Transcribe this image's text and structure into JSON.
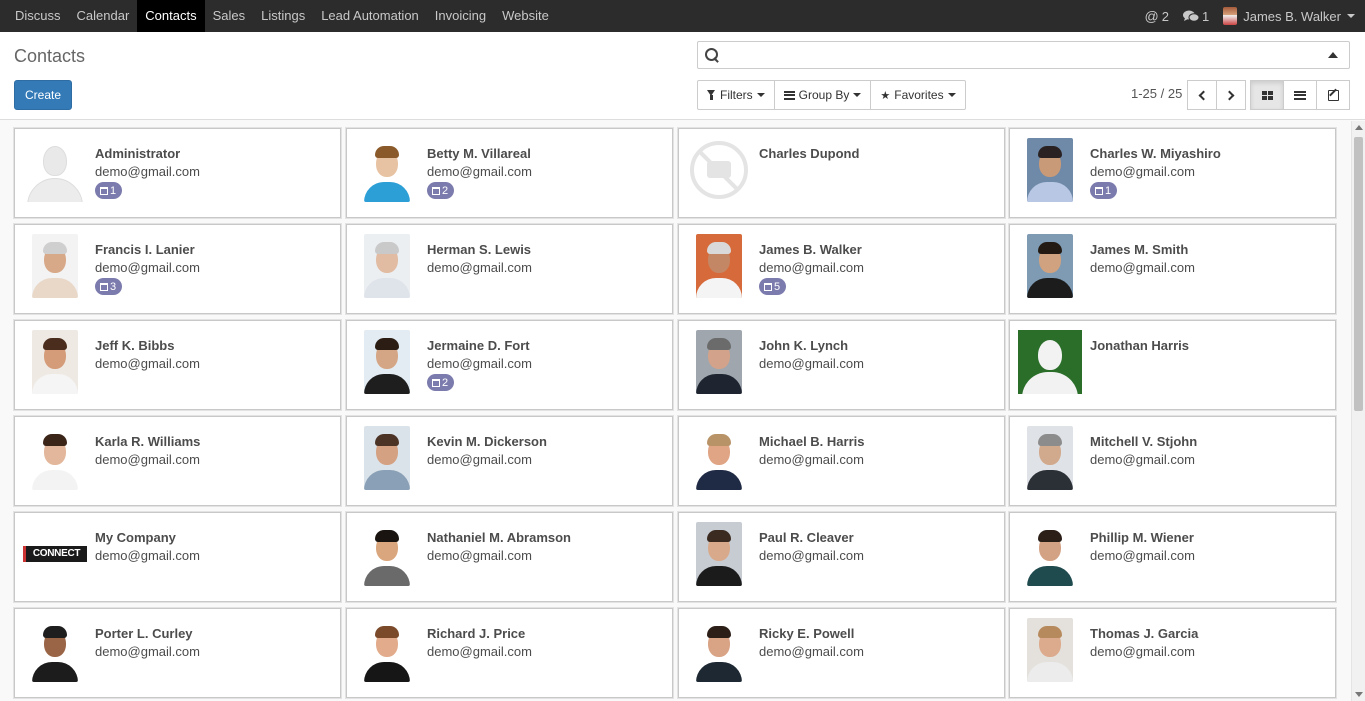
{
  "nav": {
    "menu": [
      {
        "label": "Discuss",
        "active": false
      },
      {
        "label": "Calendar",
        "active": false
      },
      {
        "label": "Contacts",
        "active": true
      },
      {
        "label": "Sales",
        "active": false
      },
      {
        "label": "Listings",
        "active": false
      },
      {
        "label": "Lead Automation",
        "active": false
      },
      {
        "label": "Invoicing",
        "active": false
      },
      {
        "label": "Website",
        "active": false
      }
    ],
    "mentions_count": "2",
    "messages_count": "1",
    "user_name": "James B. Walker"
  },
  "control": {
    "title": "Contacts",
    "create_label": "Create",
    "search_placeholder": "",
    "filters_label": "Filters",
    "groupby_label": "Group By",
    "favorites_label": "Favorites",
    "pager": "1-25 / 25",
    "active_view": "kanban"
  },
  "contacts": [
    {
      "name": "Administrator",
      "email": "demo@gmail.com",
      "badge": "1",
      "avatar": "placeholder"
    },
    {
      "name": "Betty M. Villareal",
      "email": "demo@gmail.com",
      "badge": "2",
      "avatar": "photo",
      "colors": [
        "#ffffff",
        "#e8c3a3",
        "#8a5a2b",
        "#2c9fd6"
      ]
    },
    {
      "name": "Charles Dupond",
      "email": "",
      "badge": "",
      "avatar": "no-image"
    },
    {
      "name": "Charles W. Miyashiro",
      "email": "demo@gmail.com",
      "badge": "1",
      "avatar": "photo",
      "colors": [
        "#6f8aa8",
        "#c99a78",
        "#2a2222",
        "#b8c8e4"
      ]
    },
    {
      "name": "Francis I. Lanier",
      "email": "demo@gmail.com",
      "badge": "3",
      "avatar": "photo",
      "colors": [
        "#f3f3f3",
        "#d8a989",
        "#cfcfcf",
        "#e9d8c8"
      ]
    },
    {
      "name": "Herman S. Lewis",
      "email": "demo@gmail.com",
      "badge": "",
      "avatar": "photo",
      "colors": [
        "#eceff2",
        "#e1bca3",
        "#c9c9c9",
        "#dfe3ea"
      ]
    },
    {
      "name": "James B. Walker",
      "email": "demo@gmail.com",
      "badge": "5",
      "avatar": "photo",
      "colors": [
        "#d66a3a",
        "#c48765",
        "#d9d9d9",
        "#f4f4f4"
      ]
    },
    {
      "name": "James M. Smith",
      "email": "demo@gmail.com",
      "badge": "",
      "avatar": "photo",
      "colors": [
        "#7e9bb3",
        "#d1a27f",
        "#231a14",
        "#1c1c1c"
      ]
    },
    {
      "name": "Jeff K. Bibbs",
      "email": "demo@gmail.com",
      "badge": "",
      "avatar": "photo",
      "colors": [
        "#efe9e4",
        "#d49c79",
        "#4a2d1c",
        "#f5f5f5"
      ]
    },
    {
      "name": "Jermaine D. Fort",
      "email": "demo@gmail.com",
      "badge": "2",
      "avatar": "photo",
      "colors": [
        "#e3ecf3",
        "#d5a685",
        "#2b1d14",
        "#1e1e1e"
      ]
    },
    {
      "name": "John K. Lynch",
      "email": "demo@gmail.com",
      "badge": "",
      "avatar": "photo",
      "colors": [
        "#9fa6ae",
        "#d2a38a",
        "#6b6b6b",
        "#1f2530"
      ]
    },
    {
      "name": "Jonathan Harris",
      "email": "",
      "badge": "",
      "avatar": "green-placeholder"
    },
    {
      "name": "Karla R. Williams",
      "email": "demo@gmail.com",
      "badge": "",
      "avatar": "photo",
      "colors": [
        "#ffffff",
        "#e2b79b",
        "#3b2418",
        "#f3f3f3"
      ]
    },
    {
      "name": "Kevin M. Dickerson",
      "email": "demo@gmail.com",
      "badge": "",
      "avatar": "photo",
      "colors": [
        "#dbe3ea",
        "#d4a283",
        "#4b3426",
        "#8aa0b6"
      ]
    },
    {
      "name": "Michael B. Harris",
      "email": "demo@gmail.com",
      "badge": "",
      "avatar": "photo",
      "colors": [
        "#ffffff",
        "#dfa585",
        "#b89368",
        "#1f2a44"
      ]
    },
    {
      "name": "Mitchell V. Stjohn",
      "email": "demo@gmail.com",
      "badge": "",
      "avatar": "photo",
      "colors": [
        "#dfe3e7",
        "#d1a98d",
        "#8c8c8c",
        "#2b2f36"
      ]
    },
    {
      "name": "My Company",
      "email": "demo@gmail.com",
      "badge": "",
      "avatar": "logo",
      "logo_text": "CONNECT"
    },
    {
      "name": "Nathaniel M. Abramson",
      "email": "demo@gmail.com",
      "badge": "",
      "avatar": "photo",
      "colors": [
        "#ffffff",
        "#d9a67d",
        "#1a1410",
        "#6a6a6a"
      ]
    },
    {
      "name": "Paul R. Cleaver",
      "email": "demo@gmail.com",
      "badge": "",
      "avatar": "photo",
      "colors": [
        "#c7ccd3",
        "#d8aa8b",
        "#3a2a20",
        "#1b1b1b"
      ]
    },
    {
      "name": "Phillip M. Wiener",
      "email": "demo@gmail.com",
      "badge": "",
      "avatar": "photo",
      "colors": [
        "#ffffff",
        "#d3a184",
        "#2b1f18",
        "#1f4a4e"
      ]
    },
    {
      "name": "Porter L. Curley",
      "email": "demo@gmail.com",
      "badge": "",
      "avatar": "photo",
      "colors": [
        "#ffffff",
        "#9a6546",
        "#1e1e1e",
        "#1c1c1c"
      ]
    },
    {
      "name": "Richard J. Price",
      "email": "demo@gmail.com",
      "badge": "",
      "avatar": "photo",
      "colors": [
        "#ffffff",
        "#e2ac8c",
        "#7a4a2a",
        "#161616"
      ]
    },
    {
      "name": "Ricky E. Powell",
      "email": "demo@gmail.com",
      "badge": "",
      "avatar": "photo",
      "colors": [
        "#ffffff",
        "#d9a386",
        "#2c1f17",
        "#1d2833"
      ]
    },
    {
      "name": "Thomas J. Garcia",
      "email": "demo@gmail.com",
      "badge": "",
      "avatar": "photo",
      "colors": [
        "#e4e1dc",
        "#dcaa8c",
        "#b78a5e",
        "#ececec"
      ]
    }
  ]
}
